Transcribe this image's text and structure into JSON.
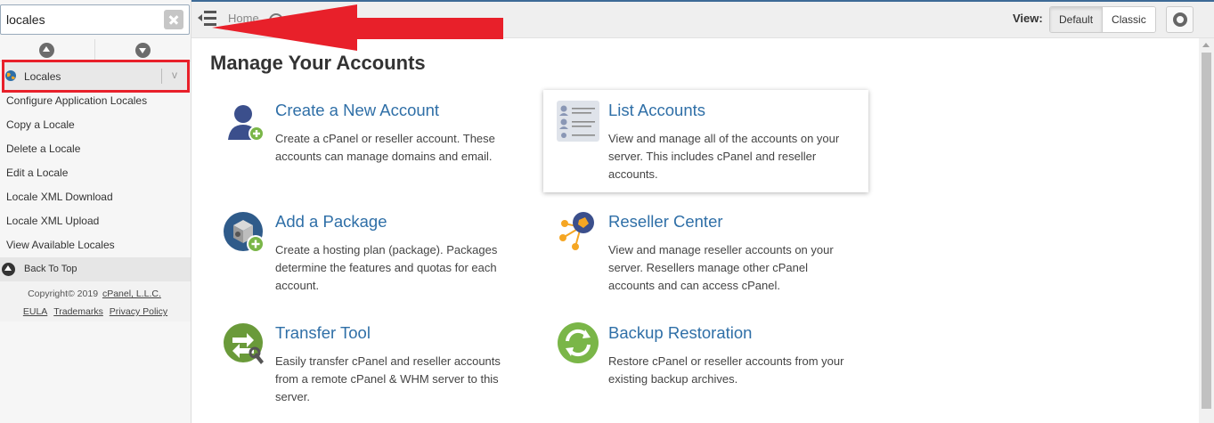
{
  "search": {
    "value": "locales",
    "placeholder": ""
  },
  "sidebar": {
    "category": {
      "label": "Locales"
    },
    "items": [
      {
        "label": "Configure Application Locales"
      },
      {
        "label": "Copy a Locale"
      },
      {
        "label": "Delete a Locale"
      },
      {
        "label": "Edit a Locale"
      },
      {
        "label": "Locale XML Download"
      },
      {
        "label": "Locale XML Upload"
      },
      {
        "label": "View Available Locales"
      }
    ],
    "back_to_top": "Back To Top",
    "footer": {
      "copyright": "Copyright© 2019",
      "company_link": "cPanel, L.L.C.",
      "eula": "EULA",
      "trademarks": "Trademarks",
      "privacy": "Privacy Policy"
    }
  },
  "topbar": {
    "breadcrumb_home": "Home",
    "view_label": "View:",
    "view_default": "Default",
    "view_classic": "Classic"
  },
  "main": {
    "title": "Manage Your Accounts",
    "cards": [
      {
        "title": "Create a New Account",
        "description": "Create a cPanel or reseller account. These accounts can manage domains and email.",
        "icon": "user-add-icon"
      },
      {
        "title": "List Accounts",
        "description": "View and manage all of the accounts on your server. This includes cPanel and reseller accounts.",
        "icon": "list-accounts-icon"
      },
      {
        "title": "Add a Package",
        "description": "Create a hosting plan (package). Packages determine the features and quotas for each account.",
        "icon": "package-add-icon"
      },
      {
        "title": "Reseller Center",
        "description": "View and manage reseller accounts on your server. Resellers manage other cPanel accounts and can access cPanel.",
        "icon": "reseller-center-icon"
      },
      {
        "title": "Transfer Tool",
        "description": "Easily transfer cPanel and reseller accounts from a remote cPanel & WHM server to this server.",
        "icon": "transfer-tool-icon"
      },
      {
        "title": "Backup Restoration",
        "description": "Restore cPanel or reseller accounts from your existing backup archives.",
        "icon": "backup-restoration-icon"
      }
    ]
  },
  "colors": {
    "link_blue": "#2f6fa7",
    "annotation_red": "#e8202a",
    "topbar_bg": "#efefef",
    "sidebar_bg": "#f6f6f6"
  }
}
